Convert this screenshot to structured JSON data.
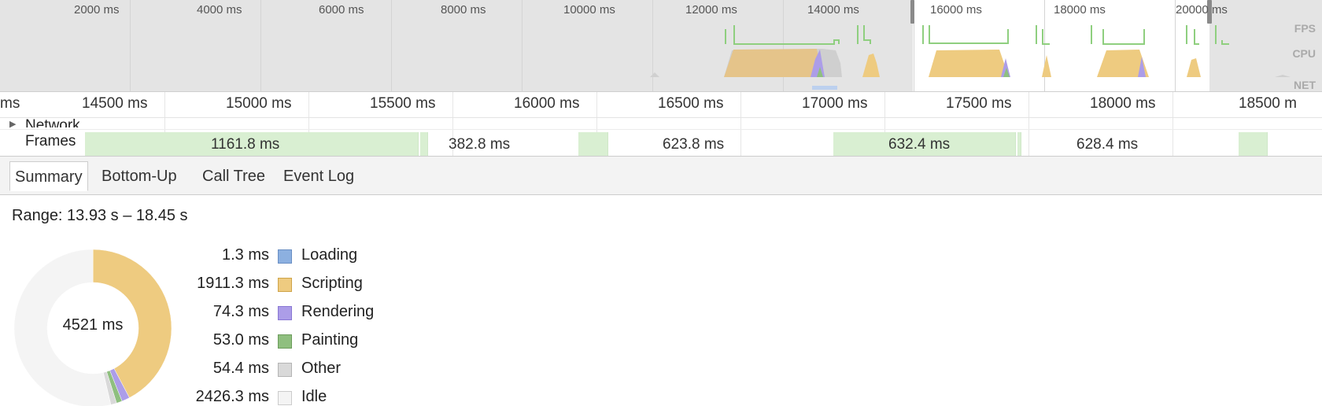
{
  "overview": {
    "ticks": [
      {
        "label": "2000 ms"
      },
      {
        "label": "4000 ms"
      },
      {
        "label": "6000 ms"
      },
      {
        "label": "8000 ms"
      },
      {
        "label": "10000 ms"
      },
      {
        "label": "12000 ms"
      },
      {
        "label": "14000 ms"
      },
      {
        "label": "16000 ms"
      },
      {
        "label": "18000 ms"
      },
      {
        "label": "20000 ms"
      }
    ],
    "track_labels": {
      "fps": "FPS",
      "cpu": "CPU",
      "net": "NET"
    }
  },
  "ruler": {
    "ticks": [
      "ms",
      "14500 ms",
      "15000 ms",
      "15500 ms",
      "16000 ms",
      "16500 ms",
      "17000 ms",
      "17500 ms",
      "18000 ms",
      "18500 m"
    ]
  },
  "tracks": {
    "network_label": "Network",
    "frames_label": "Frames",
    "frames": [
      {
        "label": "1161.8 ms"
      },
      {
        "label": "382.8 ms"
      },
      {
        "label": "623.8 ms"
      },
      {
        "label": "632.4 ms"
      },
      {
        "label": "628.4 ms"
      }
    ]
  },
  "tabs": [
    {
      "label": "Summary",
      "active": true
    },
    {
      "label": "Bottom-Up",
      "active": false
    },
    {
      "label": "Call Tree",
      "active": false
    },
    {
      "label": "Event Log",
      "active": false
    }
  ],
  "summary": {
    "range_text": "Range: 13.93 s – 18.45 s",
    "total_text": "4521 ms",
    "total_ms": 4521,
    "categories": [
      {
        "name": "Loading",
        "value_text": "1.3 ms",
        "value_ms": 1.3,
        "color": "#8cb0e0",
        "border": "#6a8fc4"
      },
      {
        "name": "Scripting",
        "value_text": "1911.3 ms",
        "value_ms": 1911.3,
        "color": "#eecb80",
        "border": "#cfa44a"
      },
      {
        "name": "Rendering",
        "value_text": "74.3 ms",
        "value_ms": 74.3,
        "color": "#ac9de8",
        "border": "#8a78d4"
      },
      {
        "name": "Painting",
        "value_text": "53.0 ms",
        "value_ms": 53.0,
        "color": "#8fbf7f",
        "border": "#6c9c5c"
      },
      {
        "name": "Other",
        "value_text": "54.4 ms",
        "value_ms": 54.4,
        "color": "#d9d9d9",
        "border": "#b5b5b5"
      },
      {
        "name": "Idle",
        "value_text": "2426.3 ms",
        "value_ms": 2426.3,
        "color": "#f4f4f4",
        "border": "#cccccc"
      }
    ]
  },
  "colors": {
    "scripting": "#eecb80",
    "rendering": "#ac9de8",
    "painting": "#8fbf7f",
    "fps_line": "#8fcf7f",
    "frame_bg": "#d9efd2",
    "overview_bg": "#e4e4e4"
  }
}
